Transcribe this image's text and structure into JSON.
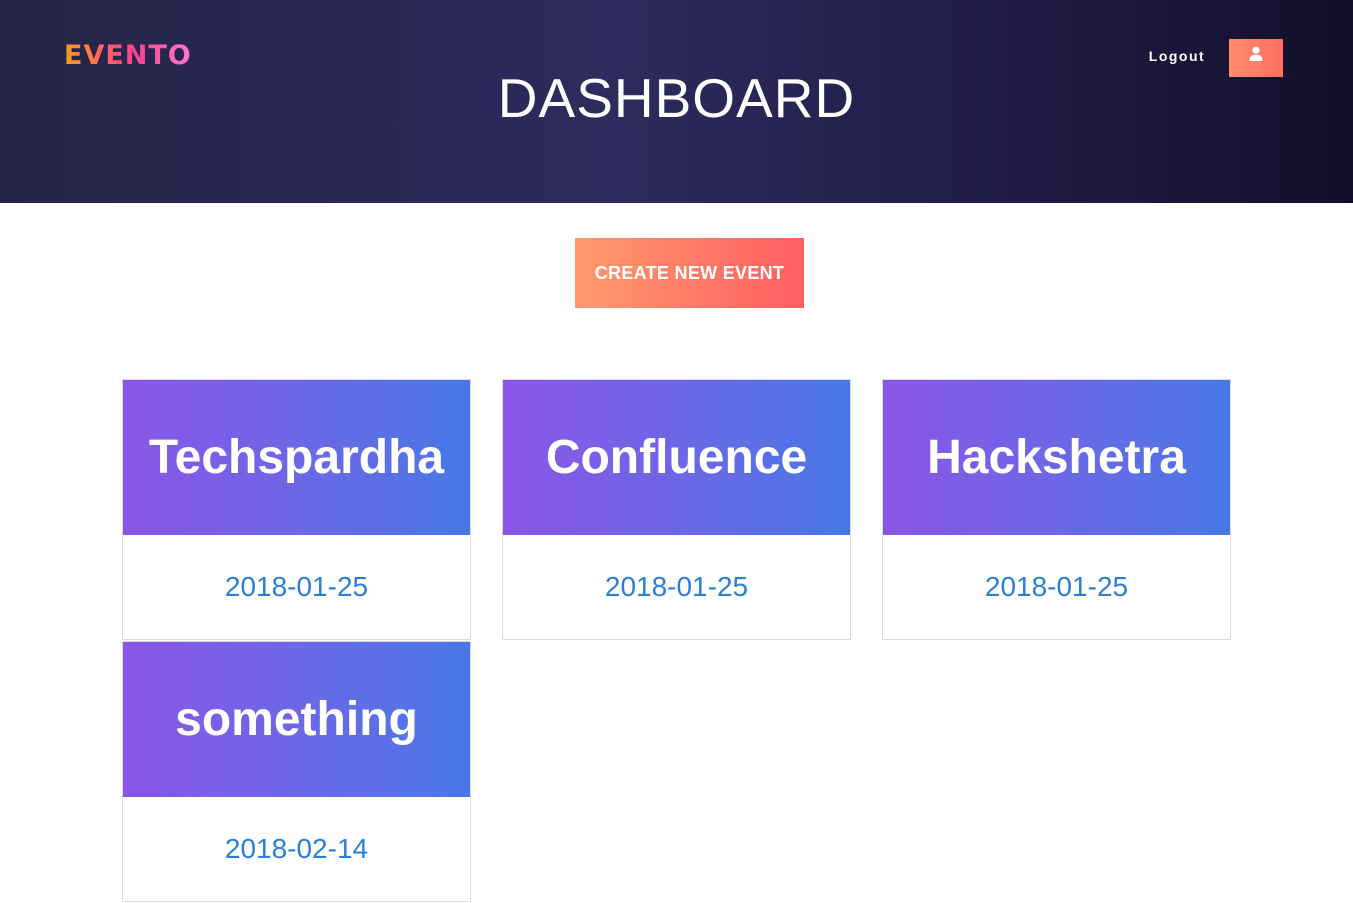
{
  "header": {
    "logo": "EVENTO",
    "title": "DASHBOARD",
    "logout_label": "Logout",
    "user_icon": "user-icon"
  },
  "actions": {
    "create_label": "CREATE NEW EVENT"
  },
  "events": [
    {
      "name": "Techspardha",
      "date": "2018-01-25"
    },
    {
      "name": "Confluence",
      "date": "2018-01-25"
    },
    {
      "name": "Hackshetra",
      "date": "2018-01-25"
    },
    {
      "name": "something",
      "date": "2018-02-14"
    }
  ],
  "colors": {
    "header_bg": "#2e2b5e",
    "accent_orange": "#ff7a5e",
    "card_purple": "#8b55e8",
    "card_blue": "#4878e6",
    "date_blue": "#2b7fd6"
  }
}
